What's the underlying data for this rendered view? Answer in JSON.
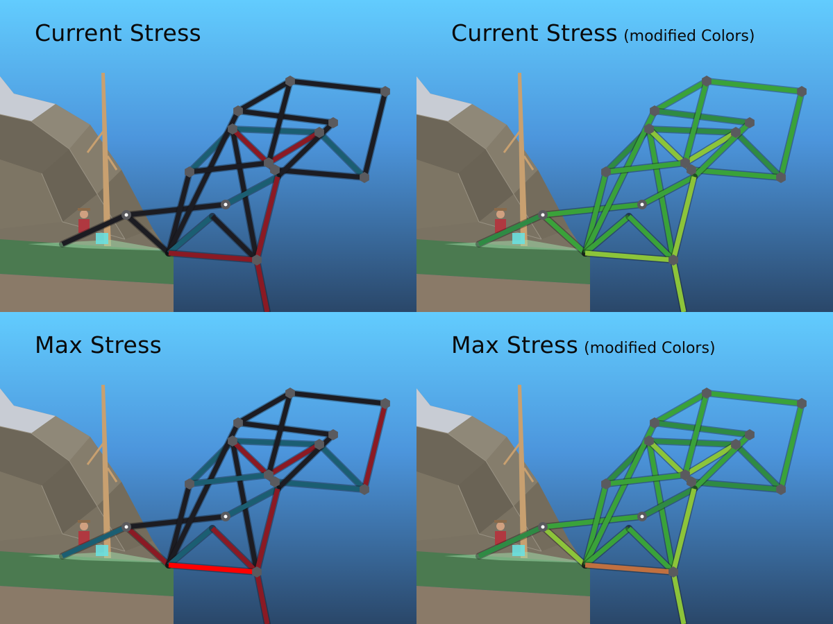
{
  "panels": [
    {
      "title": "Current Stress",
      "subtitle": "",
      "palette": "classic",
      "mode": "current"
    },
    {
      "title": "Current Stress",
      "subtitle": "(modified Colors)",
      "palette": "green",
      "mode": "current"
    },
    {
      "title": "Max Stress",
      "subtitle": "",
      "palette": "classic",
      "mode": "max"
    },
    {
      "title": "Max Stress",
      "subtitle": "(modified Colors)",
      "palette": "green",
      "mode": "max"
    }
  ],
  "colors": {
    "sky_top": "#62ccfe",
    "sky_bottom": "#2a4769",
    "grass": "#4b7a50",
    "dirt": "#8a7a68",
    "rock": "#7a7262",
    "joint": "#5a5a5e",
    "classic_low": "#1c1c22",
    "classic_tension": "#8a1a24",
    "classic_compression": "#1b5e72",
    "classic_max": "#ff0000",
    "green_low": "#3aa23a",
    "green_mid": "#8cc43a",
    "green_high": "#c07040"
  },
  "icons": [
    "anchor-joint-icon",
    "joint-icon"
  ]
}
